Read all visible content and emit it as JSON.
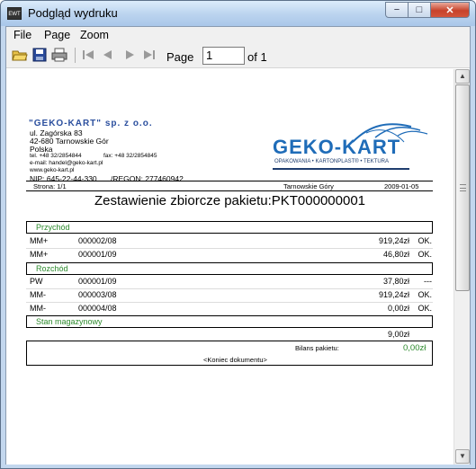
{
  "window": {
    "title": "Podgląd wydruku",
    "icon_text": "EWT",
    "minimize": "−",
    "maximize": "□",
    "close": "✕"
  },
  "menu": {
    "items": [
      "File",
      "Page",
      "Zoom"
    ]
  },
  "toolbar": {
    "page_label": "Page",
    "page_value": "1",
    "of_label": "of 1"
  },
  "document": {
    "company": "\"GEKO-KART\" sp. z o.o.",
    "address1": "ul. Zagórska 83",
    "address2": "42-680   Tarnowskie Gór",
    "country": "Polska",
    "tel": "tel. +48 32/2854844",
    "fax": "fax: +48 32/2854845",
    "email": "e-mail: handel@geko-kart.pl",
    "www": "www.geko-kart.pl",
    "nip": "NIP: 645-22-44-330",
    "regon": "/REGON: 277460942",
    "logo": "GEKO-KART",
    "logo_tag": "OPAKOWANIA  •  KARTONPLAST®  •  TEKTURA",
    "page_info": "Strona: 1/1",
    "city": "Tarnowskie   Góry",
    "date": "2009-01-05",
    "title": "Zestawienie zbiorcze pakietu:PKT000000001",
    "sections": {
      "przychod": "Przychód",
      "rozchod": "Rozchód",
      "stan": "Stan magazynowy"
    },
    "przychod_rows": [
      {
        "type": "MM+",
        "doc": "000002/08",
        "amount": "919,24zł",
        "status": "OK."
      },
      {
        "type": "MM+",
        "doc": "000001/09",
        "amount": "46,80zł",
        "status": "OK."
      }
    ],
    "rozchod_rows": [
      {
        "type": "PW",
        "doc": "000001/09",
        "amount": "37,80zł",
        "status": "---"
      },
      {
        "type": "MM-",
        "doc": "000003/08",
        "amount": "919,24zł",
        "status": "OK."
      },
      {
        "type": "MM-",
        "doc": "000004/08",
        "amount": "0,00zł",
        "status": "OK."
      }
    ],
    "stan_value": "9,00zł",
    "bilans_label": "Bilans  pakietu:",
    "bilans_value": "0,00zł",
    "end": "<Koniec  dokumentu>"
  }
}
